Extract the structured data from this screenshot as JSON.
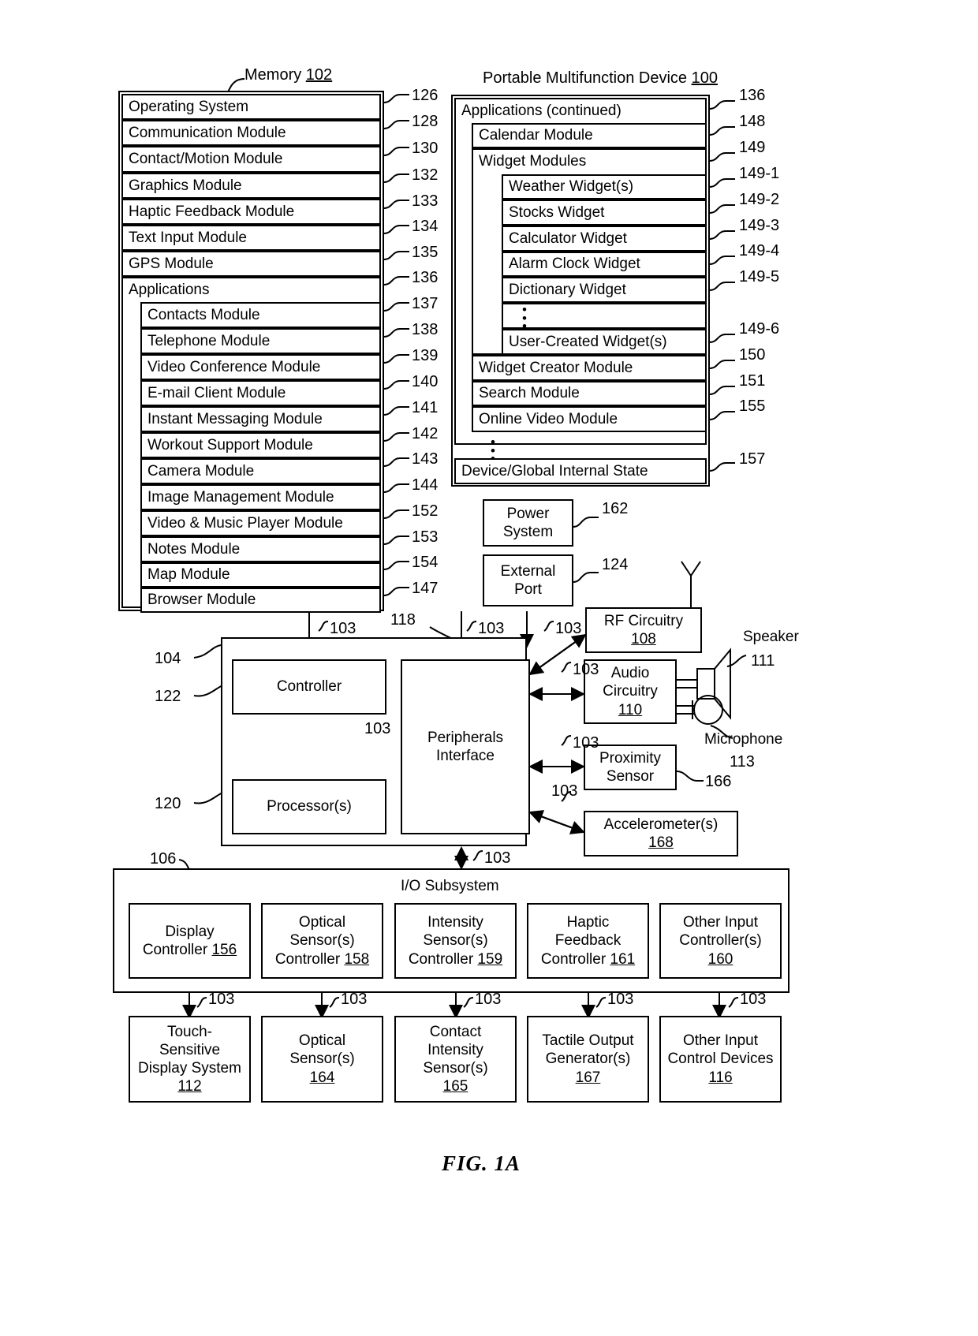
{
  "figure": {
    "caption": "FIG. 1A"
  },
  "memory": {
    "title": "Memory",
    "title_ref": "102",
    "items": [
      {
        "label": "Operating System",
        "ref": "126"
      },
      {
        "label": "Communication Module",
        "ref": "128"
      },
      {
        "label": "Contact/Motion Module",
        "ref": "130"
      },
      {
        "label": "Graphics Module",
        "ref": "132"
      },
      {
        "label": "Haptic Feedback Module",
        "ref": "133"
      },
      {
        "label": "Text Input Module",
        "ref": "134"
      },
      {
        "label": "GPS Module",
        "ref": "135"
      },
      {
        "label": "Applications",
        "ref": "136"
      }
    ],
    "applications": [
      {
        "label": "Contacts Module",
        "ref": "137"
      },
      {
        "label": "Telephone Module",
        "ref": "138"
      },
      {
        "label": "Video Conference Module",
        "ref": "139"
      },
      {
        "label": "E-mail Client Module",
        "ref": "140"
      },
      {
        "label": "Instant Messaging Module",
        "ref": "141"
      },
      {
        "label": "Workout Support Module",
        "ref": "142"
      },
      {
        "label": "Camera Module",
        "ref": "143"
      },
      {
        "label": "Image Management Module",
        "ref": "144"
      },
      {
        "label": "Video & Music Player Module",
        "ref": "152"
      },
      {
        "label": "Notes Module",
        "ref": "153"
      },
      {
        "label": "Map Module",
        "ref": "154"
      },
      {
        "label": "Browser Module",
        "ref": "147"
      }
    ]
  },
  "device": {
    "title": "Portable Multifunction Device",
    "title_ref": "100",
    "applications_continued": {
      "label": "Applications (continued)",
      "ref": "136"
    },
    "modules": [
      {
        "label": "Calendar Module",
        "ref": "148"
      },
      {
        "label": "Widget Modules",
        "ref": "149"
      }
    ],
    "widgets": [
      {
        "label": "Weather Widget(s)",
        "ref": "149-1"
      },
      {
        "label": "Stocks Widget",
        "ref": "149-2"
      },
      {
        "label": "Calculator Widget",
        "ref": "149-3"
      },
      {
        "label": "Alarm Clock Widget",
        "ref": "149-4"
      },
      {
        "label": "Dictionary Widget",
        "ref": "149-5"
      },
      {
        "label": "User-Created Widget(s)",
        "ref": "149-6"
      }
    ],
    "trailing_modules": [
      {
        "label": "Widget Creator Module",
        "ref": "150"
      },
      {
        "label": "Search Module",
        "ref": "151"
      },
      {
        "label": "Online Video Module",
        "ref": "155"
      }
    ],
    "internal_state": {
      "label": "Device/Global Internal State",
      "ref": "157"
    }
  },
  "blocks": {
    "power_system": {
      "line1": "Power",
      "line2": "System",
      "ref": "162"
    },
    "external_port": {
      "line1": "External",
      "line2": "Port",
      "ref": "124"
    },
    "rf_circuitry": {
      "line1": "RF Circuitry",
      "ref": "108"
    },
    "audio_circuitry": {
      "line1": "Audio",
      "line2": "Circuitry",
      "ref": "110"
    },
    "proximity_sensor": {
      "line1": "Proximity",
      "line2": "Sensor",
      "ref": "166"
    },
    "accelerometer": {
      "line1": "Accelerometer(s)",
      "ref": "168"
    },
    "controller": {
      "label": "Controller",
      "ref": "122"
    },
    "processor": {
      "label": "Processor(s)",
      "ref": "120"
    },
    "peripherals_interface": {
      "line1": "Peripherals",
      "line2": "Interface",
      "ref": "118"
    },
    "cpu_group_ref": "104",
    "speaker": {
      "label": "Speaker",
      "ref": "111"
    },
    "microphone": {
      "label": "Microphone",
      "ref": "113"
    },
    "io_subsystem": {
      "label": "I/O Subsystem",
      "ref": "106"
    }
  },
  "io_controllers": [
    {
      "line1": "Display",
      "line2": "Controller",
      "ref": "156"
    },
    {
      "line1": "Optical",
      "line2": "Sensor(s)",
      "line3": "Controller",
      "ref": "158"
    },
    {
      "line1": "Intensity",
      "line2": "Sensor(s)",
      "line3": "Controller",
      "ref": "159"
    },
    {
      "line1": "Haptic",
      "line2": "Feedback",
      "line3": "Controller",
      "ref": "161"
    },
    {
      "line1": "Other Input",
      "line2": "Controller(s)",
      "ref": "160"
    }
  ],
  "io_devices": [
    {
      "line1": "Touch-",
      "line2": "Sensitive",
      "line3": "Display System",
      "ref": "112"
    },
    {
      "line1": "Optical",
      "line2": "Sensor(s)",
      "ref": "164"
    },
    {
      "line1": "Contact",
      "line2": "Intensity",
      "line3": "Sensor(s)",
      "ref": "165"
    },
    {
      "line1": "Tactile Output",
      "line2": "Generator(s)",
      "ref": "167"
    },
    {
      "line1": "Other Input",
      "line2": "Control Devices",
      "ref": "116"
    }
  ],
  "bus_ref": "103",
  "bus_labels": {
    "memory_to_cpu": "103",
    "peripherals_in": "103",
    "rf": "103",
    "audio": "103",
    "proximity": "103",
    "accelerometer": "103",
    "controller_peripherals": "103",
    "io": "103"
  }
}
